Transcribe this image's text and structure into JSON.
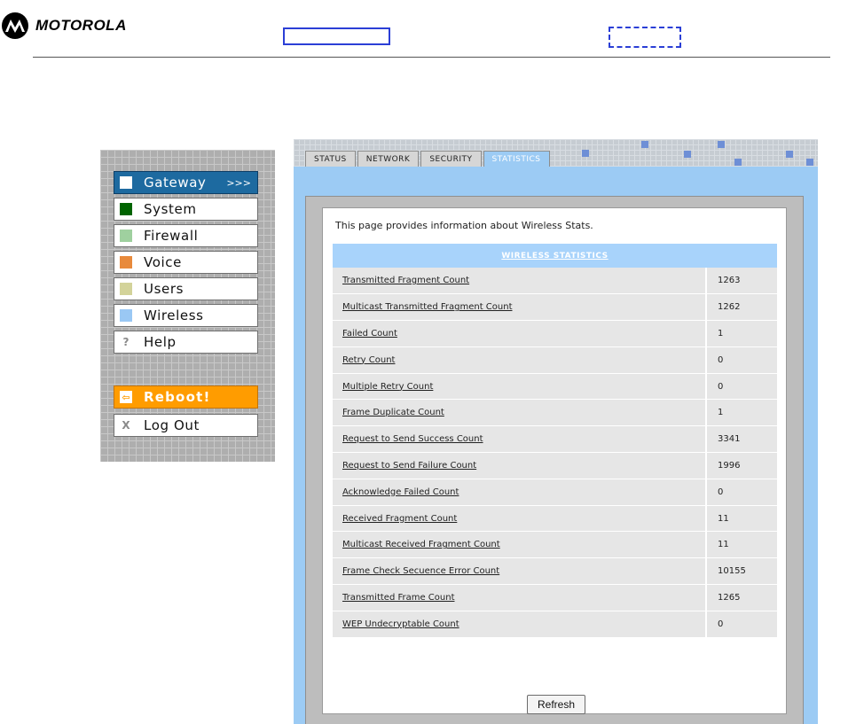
{
  "brand": {
    "name": "MOTOROLA",
    "icon": "motorola-batwing-logo-icon"
  },
  "nav": {
    "items": [
      {
        "label": "Gateway",
        "swatch": "#ffffff",
        "active": true,
        "arrow": ">>>"
      },
      {
        "label": "System",
        "swatch": "#006400"
      },
      {
        "label": "Firewall",
        "swatch": "#9fd09f"
      },
      {
        "label": "Voice",
        "swatch": "#e88a3c"
      },
      {
        "label": "Users",
        "swatch": "#d3d39a"
      },
      {
        "label": "Wireless",
        "swatch": "#9ac8f4"
      },
      {
        "label": "Help",
        "icon": "question-icon",
        "glyph": "?"
      },
      {
        "label": "Reboot!",
        "icon": "back-arrow-icon",
        "glyph": "⇦"
      },
      {
        "label": "Log Out",
        "icon": "x-icon",
        "glyph": "X"
      }
    ]
  },
  "tabs": [
    "STATUS",
    "NETWORK",
    "SECURITY",
    "STATISTICS"
  ],
  "active_tab": "STATISTICS",
  "intro": "This page provides information about Wireless Stats.",
  "table": {
    "header": "WIRELESS STATISTICS",
    "rows": [
      {
        "name": "Transmitted Fragment Count",
        "value": "1263"
      },
      {
        "name": "Multicast Transmitted Fragment Count",
        "value": "1262"
      },
      {
        "name": "Failed Count",
        "value": "1"
      },
      {
        "name": "Retry Count",
        "value": "0"
      },
      {
        "name": "Multiple Retry Count",
        "value": "0"
      },
      {
        "name": "Frame Duplicate Count",
        "value": "1"
      },
      {
        "name": "Request to Send Success Count",
        "value": "3341"
      },
      {
        "name": "Request to Send Failure Count",
        "value": "1996"
      },
      {
        "name": "Acknowledge Failed Count",
        "value": "0"
      },
      {
        "name": "Received Fragment Count",
        "value": "11"
      },
      {
        "name": "Multicast Received Fragment Count",
        "value": "11"
      },
      {
        "name": "Frame Check Secuence Error Count",
        "value": "10155"
      },
      {
        "name": "Transmitted Frame Count",
        "value": "1265"
      },
      {
        "name": "WEP Undecryptable Count",
        "value": "0"
      }
    ]
  },
  "refresh_label": "Refresh"
}
